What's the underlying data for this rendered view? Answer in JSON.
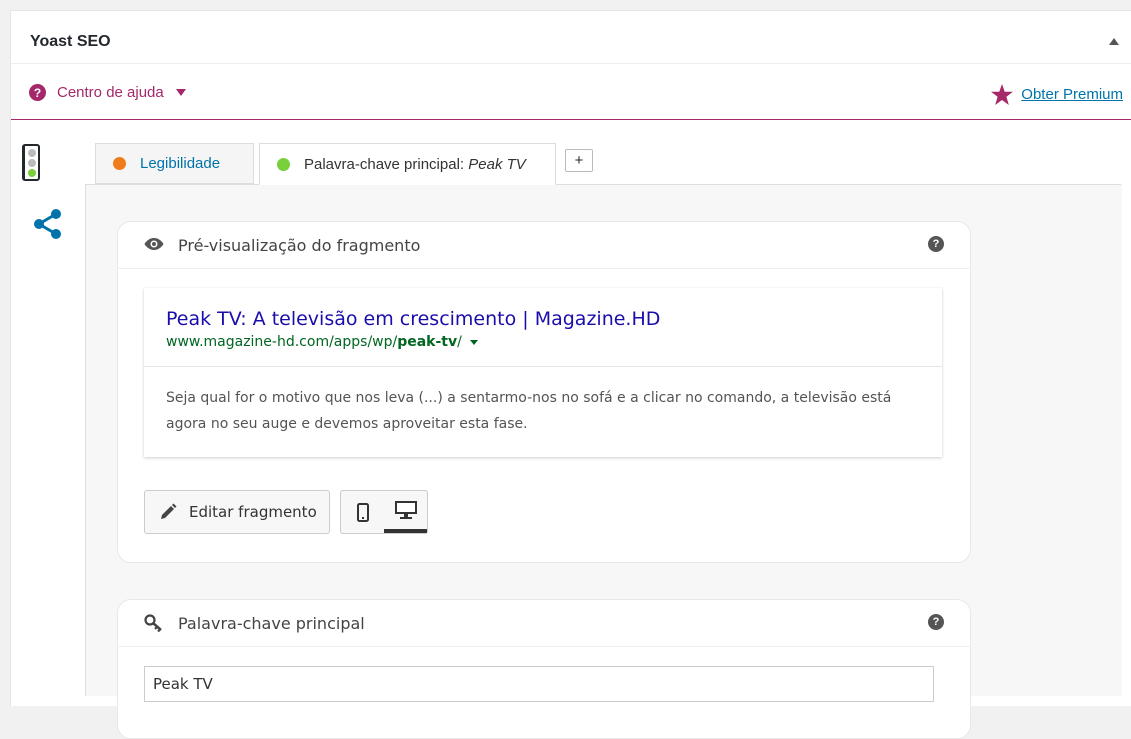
{
  "metabox": {
    "title": "Yoast SEO"
  },
  "helpbar": {
    "help_label": "Centro de ajuda",
    "premium_label": "Obter Premium"
  },
  "tabs": [
    {
      "label": "Legibilidade",
      "status_color": "#ee7c1b"
    },
    {
      "label_prefix": "Palavra-chave principal: ",
      "label_keyword": "Peak TV",
      "status_color": "#7ad03a"
    }
  ],
  "add_tab_label": "+",
  "snippet": {
    "heading": "Pré-visualização do fragmento",
    "title": "Peak TV: A televisão em crescimento | Magazine.HD",
    "url_base": "www.magazine-hd.com/apps/wp/",
    "url_slug": "peak-tv",
    "url_suffix": "/",
    "description": "Seja qual for o motivo que nos leva (...) a sentarmo-nos no sofá e a clicar no comando, a televisão está agora no seu auge e devemos aproveitar esta fase.",
    "edit_label": "Editar fragmento"
  },
  "focus_keyphrase": {
    "heading": "Palavra-chave principal",
    "value": "Peak TV"
  },
  "colors": {
    "brand": "#a4286a",
    "link": "#0073aa",
    "serp_title": "#1a0dab",
    "serp_url": "#006621"
  }
}
